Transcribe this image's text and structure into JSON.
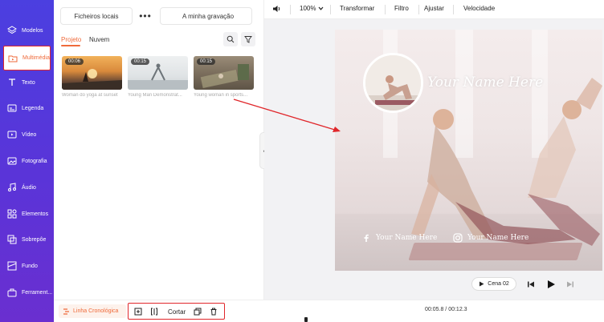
{
  "sidebar": {
    "items": [
      {
        "label": "Modelos",
        "icon": "layers-icon"
      },
      {
        "label": "Multimédia",
        "icon": "folder-icon"
      },
      {
        "label": "Texto",
        "icon": "text-icon"
      },
      {
        "label": "Legenda",
        "icon": "caption-icon"
      },
      {
        "label": "Vídeo",
        "icon": "video-icon"
      },
      {
        "label": "Fotografia",
        "icon": "image-icon"
      },
      {
        "label": "Áudio",
        "icon": "music-icon"
      },
      {
        "label": "Elementos",
        "icon": "elements-icon"
      },
      {
        "label": "Sobrepôe",
        "icon": "overlay-icon"
      },
      {
        "label": "Fundo",
        "icon": "background-icon"
      },
      {
        "label": "Ferrament...",
        "icon": "toolbox-icon"
      }
    ],
    "active_index": 1
  },
  "panel": {
    "local_files_label": "Ficheiros locais",
    "recording_label": "A minha gravação",
    "more_label": "•••",
    "subtabs": [
      "Projeto",
      "Nuvem"
    ],
    "active_subtab": 0,
    "media": [
      {
        "duration": "00:06",
        "caption": "Woman do yoga at sunset"
      },
      {
        "duration": "00:15",
        "caption": "Young Man Demonstrat..."
      },
      {
        "duration": "00:15",
        "caption": "Young woman in sports..."
      }
    ]
  },
  "toolbar": {
    "volume_icon": "volume-icon",
    "zoom": "100%",
    "transform": "Transformar",
    "filter": "Filtro",
    "adjust": "Ajustar",
    "speed": "Velocidade"
  },
  "canvas": {
    "title": "Your Name Here",
    "social_left": "Your Name Here",
    "social_right": "Your Name Here"
  },
  "playback": {
    "scene_label": "Cena 02"
  },
  "bottombar": {
    "timeline_label": "Linha Cronológica",
    "cut_label": "Cortar",
    "time": "00:05.8 / 00:12.3"
  },
  "colors": {
    "accent": "#ef6a3a",
    "sidebar_top": "#4b3fe0",
    "sidebar_bottom": "#6a2fd0",
    "highlight": "#e0262a"
  }
}
